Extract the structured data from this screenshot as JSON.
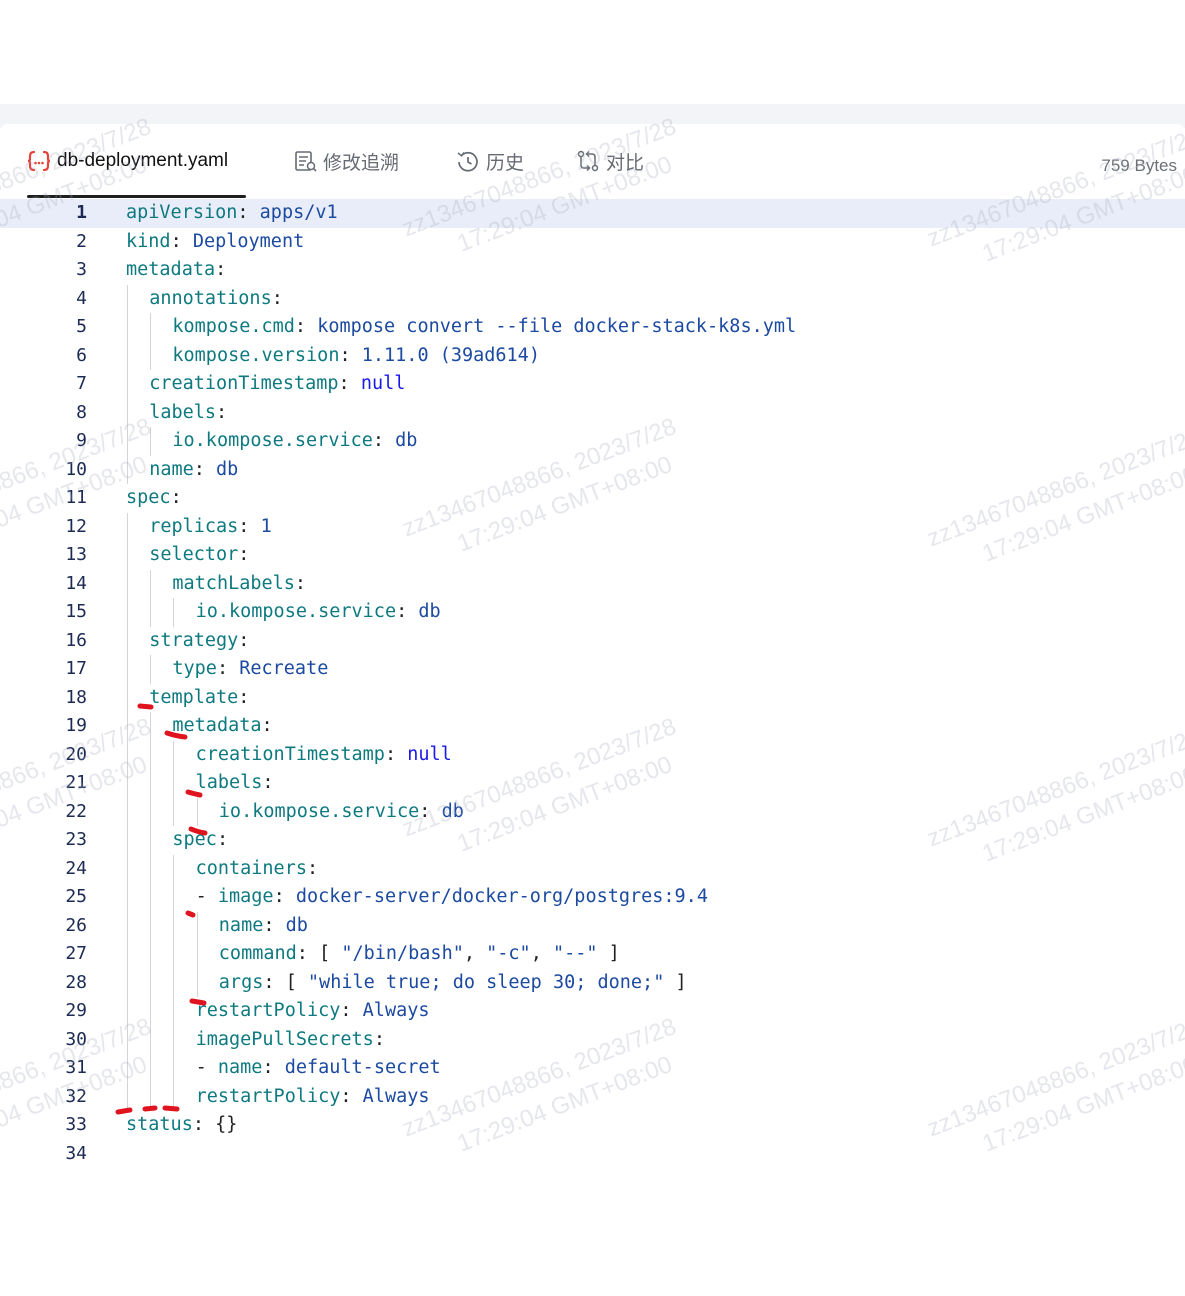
{
  "tabs": [
    {
      "label": "db-deployment.yaml",
      "icon": "code-braces-icon",
      "active": true
    },
    {
      "label": "修改追溯",
      "icon": "document-list-icon",
      "active": false
    },
    {
      "label": "历史",
      "icon": "clock-history-icon",
      "active": false
    },
    {
      "label": "对比",
      "icon": "compare-icon",
      "active": false
    }
  ],
  "file_size": "759 Bytes",
  "watermark": {
    "line1": "zz13467048866, 2023/7/28",
    "line2": "17:29:04 GMT+08:00"
  },
  "editor": {
    "current_line": 1,
    "lines": [
      {
        "n": "1",
        "indent": 0,
        "parts": [
          [
            "k",
            "apiVersion"
          ],
          [
            "p",
            ": "
          ],
          [
            "v",
            "apps/v1"
          ]
        ]
      },
      {
        "n": "2",
        "indent": 0,
        "parts": [
          [
            "k",
            "kind"
          ],
          [
            "p",
            ": "
          ],
          [
            "v",
            "Deployment"
          ]
        ]
      },
      {
        "n": "3",
        "indent": 0,
        "parts": [
          [
            "k",
            "metadata"
          ],
          [
            "p",
            ":"
          ]
        ]
      },
      {
        "n": "4",
        "indent": 1,
        "parts": [
          [
            "k",
            "annotations"
          ],
          [
            "p",
            ":"
          ]
        ]
      },
      {
        "n": "5",
        "indent": 2,
        "parts": [
          [
            "k",
            "kompose.cmd"
          ],
          [
            "p",
            ": "
          ],
          [
            "v",
            "kompose convert --file docker-stack-k8s.yml"
          ]
        ]
      },
      {
        "n": "6",
        "indent": 2,
        "parts": [
          [
            "k",
            "kompose.version"
          ],
          [
            "p",
            ": "
          ],
          [
            "v",
            "1.11.0 (39ad614)"
          ]
        ]
      },
      {
        "n": "7",
        "indent": 1,
        "parts": [
          [
            "k",
            "creationTimestamp"
          ],
          [
            "p",
            ": "
          ],
          [
            "kw",
            "null"
          ]
        ]
      },
      {
        "n": "8",
        "indent": 1,
        "parts": [
          [
            "k",
            "labels"
          ],
          [
            "p",
            ":"
          ]
        ]
      },
      {
        "n": "9",
        "indent": 2,
        "parts": [
          [
            "k",
            "io.kompose.service"
          ],
          [
            "p",
            ": "
          ],
          [
            "v",
            "db"
          ]
        ]
      },
      {
        "n": "10",
        "indent": 1,
        "parts": [
          [
            "k",
            "name"
          ],
          [
            "p",
            ": "
          ],
          [
            "v",
            "db"
          ]
        ]
      },
      {
        "n": "11",
        "indent": 0,
        "parts": [
          [
            "k",
            "spec"
          ],
          [
            "p",
            ":"
          ]
        ]
      },
      {
        "n": "12",
        "indent": 1,
        "parts": [
          [
            "k",
            "replicas"
          ],
          [
            "p",
            ": "
          ],
          [
            "v",
            "1"
          ]
        ]
      },
      {
        "n": "13",
        "indent": 1,
        "parts": [
          [
            "k",
            "selector"
          ],
          [
            "p",
            ":"
          ]
        ]
      },
      {
        "n": "14",
        "indent": 2,
        "parts": [
          [
            "k",
            "matchLabels"
          ],
          [
            "p",
            ":"
          ]
        ]
      },
      {
        "n": "15",
        "indent": 3,
        "parts": [
          [
            "k",
            "io.kompose.service"
          ],
          [
            "p",
            ": "
          ],
          [
            "v",
            "db"
          ]
        ]
      },
      {
        "n": "16",
        "indent": 1,
        "parts": [
          [
            "k",
            "strategy"
          ],
          [
            "p",
            ":"
          ]
        ]
      },
      {
        "n": "17",
        "indent": 2,
        "parts": [
          [
            "k",
            "type"
          ],
          [
            "p",
            ": "
          ],
          [
            "v",
            "Recreate"
          ]
        ]
      },
      {
        "n": "18",
        "indent": 1,
        "parts": [
          [
            "k",
            "template"
          ],
          [
            "p",
            ":"
          ]
        ]
      },
      {
        "n": "19",
        "indent": 2,
        "parts": [
          [
            "k",
            "metadata"
          ],
          [
            "p",
            ":"
          ]
        ]
      },
      {
        "n": "20",
        "indent": 3,
        "parts": [
          [
            "k",
            "creationTimestamp"
          ],
          [
            "p",
            ": "
          ],
          [
            "kw",
            "null"
          ]
        ]
      },
      {
        "n": "21",
        "indent": 3,
        "parts": [
          [
            "k",
            "labels"
          ],
          [
            "p",
            ":"
          ]
        ]
      },
      {
        "n": "22",
        "indent": 4,
        "parts": [
          [
            "k",
            "io.kompose.service"
          ],
          [
            "p",
            ": "
          ],
          [
            "v",
            "db"
          ]
        ]
      },
      {
        "n": "23",
        "indent": 2,
        "parts": [
          [
            "k",
            "spec"
          ],
          [
            "p",
            ":"
          ]
        ]
      },
      {
        "n": "24",
        "indent": 3,
        "parts": [
          [
            "k",
            "containers"
          ],
          [
            "p",
            ":"
          ]
        ]
      },
      {
        "n": "25",
        "indent": 3,
        "parts": [
          [
            "p",
            "- "
          ],
          [
            "k",
            "image"
          ],
          [
            "p",
            ": "
          ],
          [
            "v",
            "docker-server/docker-org/postgres:9.4"
          ]
        ]
      },
      {
        "n": "26",
        "indent": 4,
        "parts": [
          [
            "k",
            "name"
          ],
          [
            "p",
            ": "
          ],
          [
            "v",
            "db"
          ]
        ]
      },
      {
        "n": "27",
        "indent": 4,
        "parts": [
          [
            "k",
            "command"
          ],
          [
            "p",
            ": [ "
          ],
          [
            "v",
            "\"/bin/bash\""
          ],
          [
            "p",
            ", "
          ],
          [
            "v",
            "\"-c\""
          ],
          [
            "p",
            ", "
          ],
          [
            "v",
            "\"--\""
          ],
          [
            "p",
            " ]"
          ]
        ]
      },
      {
        "n": "28",
        "indent": 4,
        "parts": [
          [
            "k",
            "args"
          ],
          [
            "p",
            ": [ "
          ],
          [
            "v",
            "\"while true; do sleep 30; done;\""
          ],
          [
            "p",
            " ]"
          ]
        ]
      },
      {
        "n": "29",
        "indent": 3,
        "parts": [
          [
            "k",
            "restartPolicy"
          ],
          [
            "p",
            ": "
          ],
          [
            "v",
            "Always"
          ]
        ]
      },
      {
        "n": "30",
        "indent": 3,
        "parts": [
          [
            "k",
            "imagePullSecrets"
          ],
          [
            "p",
            ":"
          ]
        ]
      },
      {
        "n": "31",
        "indent": 3,
        "parts": [
          [
            "p",
            "- "
          ],
          [
            "k",
            "name"
          ],
          [
            "p",
            ": "
          ],
          [
            "v",
            "default-secret"
          ]
        ]
      },
      {
        "n": "32",
        "indent": 3,
        "parts": [
          [
            "k",
            "restartPolicy"
          ],
          [
            "p",
            ": "
          ],
          [
            "v",
            "Always"
          ]
        ]
      },
      {
        "n": "33",
        "indent": 0,
        "parts": [
          [
            "k",
            "status"
          ],
          [
            "p",
            ": {}"
          ]
        ]
      },
      {
        "n": "34",
        "indent": 0,
        "parts": []
      }
    ]
  },
  "colors": {
    "key": "#0e7a80",
    "value": "#1b4aa0",
    "keyword": "#1a1ae6",
    "current_line_bg": "#e9edf9",
    "tab_active_icon": "#e5433b",
    "annotation_marks": "#e0141e"
  }
}
